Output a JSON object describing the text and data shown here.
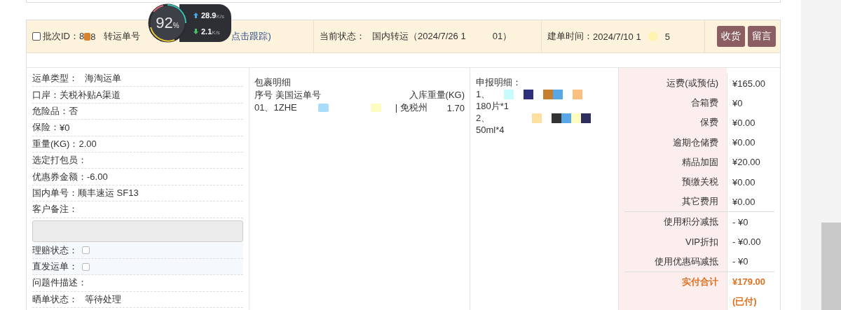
{
  "header": {
    "batch": {
      "checked": false,
      "label": "批次ID：",
      "id_start": "8",
      "id_end": "8"
    },
    "transfer": {
      "label": "转运单号",
      "link": "点击跟踪)"
    },
    "status": {
      "label": "当前状态：",
      "value_start": "国内转运（2024/7/26 1",
      "value_end": "01）"
    },
    "created": {
      "label": "建单时间：",
      "value_start": "2024/7/10 1",
      "value_end": "5"
    },
    "buttons": [
      "收货",
      "留言"
    ]
  },
  "fields": [
    {
      "kind": "text",
      "label": "运单类型：",
      "value": "海淘运单"
    },
    {
      "kind": "text",
      "label": "口岸：",
      "value": "关税补贴A渠道"
    },
    {
      "kind": "text",
      "label": "危险品：",
      "value": "否"
    },
    {
      "kind": "text",
      "label": "保险：",
      "value": "¥0"
    },
    {
      "kind": "text",
      "label": "重量(KG)：",
      "value": "2.00"
    },
    {
      "kind": "text",
      "label": "选定打包员："
    },
    {
      "kind": "text",
      "label": "优惠券金额：",
      "value": "-6.00"
    },
    {
      "kind": "text",
      "label": "国内单号：",
      "value": "顺丰速运 SF13"
    },
    {
      "kind": "text",
      "label": "客户备注："
    },
    {
      "kind": "textarea",
      "disabled": true
    },
    {
      "kind": "checkbox",
      "label": "理赔状态：",
      "checked": false
    },
    {
      "kind": "checkbox",
      "label": "直发运单：",
      "checked": false
    },
    {
      "kind": "text",
      "label": "问题件描述："
    },
    {
      "kind": "text",
      "label": "晒单状态：",
      "value": "等待处理"
    }
  ],
  "package": {
    "title": "包裹明细",
    "col_left": "序号 美国运单号",
    "col_right": "入库重量(KG)",
    "row": {
      "number": "01、1ZHE",
      "state": "| 免税州",
      "weight": "1.70"
    }
  },
  "declaration": {
    "title": "申报明细：",
    "items": [
      {
        "index": "1、",
        "quantity": "180片*1"
      },
      {
        "index": "2、",
        "quantity": "50ml*4"
      }
    ]
  },
  "fees": [
    {
      "kind": "fee",
      "label": "运费(或预估)",
      "value": "¥165.00"
    },
    {
      "kind": "fee",
      "label": "合箱费",
      "value": "¥0"
    },
    {
      "kind": "fee",
      "label": "保费",
      "value": "¥0.00"
    },
    {
      "kind": "fee",
      "label": "逾期仓储费",
      "value": "¥0.00"
    },
    {
      "kind": "fee",
      "label": "精品加固",
      "value": "¥20.00"
    },
    {
      "kind": "fee",
      "label": "预缴关税",
      "value": "¥0.00"
    },
    {
      "kind": "fee",
      "label": "其它费用",
      "value": "¥0.00"
    },
    {
      "kind": "deduction",
      "label": "使用积分减抵",
      "value": "- ¥0"
    },
    {
      "kind": "deduction",
      "label": "VIP折扣",
      "value": "- ¥0.00"
    },
    {
      "kind": "deduction",
      "label": "使用优惠码减抵",
      "value": "- ¥0"
    },
    {
      "kind": "total",
      "label": "实付合计",
      "value": "¥179.00"
    }
  ],
  "paid_note": "(已付)",
  "speed_widget": {
    "percent": "92",
    "unit": "%",
    "up": "28.9",
    "up_unit": "K/s",
    "down": "2.1",
    "down_unit": "K/s"
  }
}
